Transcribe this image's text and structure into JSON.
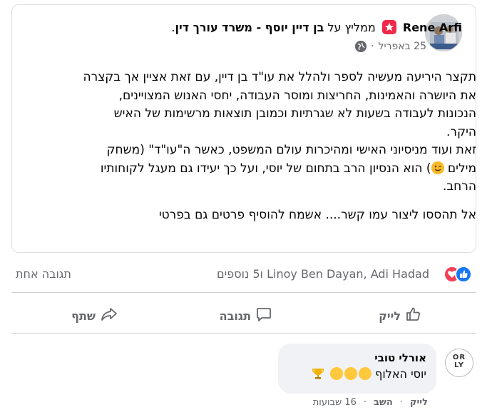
{
  "post": {
    "author": "Rene Arfi",
    "recommends_text": "ממליץ על",
    "target": "בן דיין יוסף - משרד עורך דין",
    "period": ".",
    "date": "25 באפריל",
    "date_sep": "·",
    "body_lines": [
      "תקצר היריעה מעשיה לספר ולהלל את עו\"ד בן דיין, עם זאת אציין אך בקצרה",
      "את היושרה והאמינות, החריצות ומוסר העבודה, יחסי האנוש המצויינים,",
      "הנכונות לעבודה בשעות לא שגרתיות וכמובן תוצאות מרשימות של האיש",
      "היקר.",
      "זאת ועוד מניסיוני האישי ומהיכרות עולם המשפט,  כאשר ה\"עו\"ד\" (משחק",
      "מילים",
      ") הוא הנסיון הרב בתחום של יוסי, ועל כך יעידו גם  מעגל לקוחותיו",
      "הרחב.",
      "אל תהססו ליצור עמו קשר.... אשמח להוסיף פרטים גם בפרטי"
    ]
  },
  "reactions": {
    "reactors": "Linoy Ben Dayan, Adi Hadad ו5 נוספים",
    "comment_count": "תגובה אחת"
  },
  "actions": {
    "like": "לייק",
    "comment": "תגובה",
    "share": "שתף"
  },
  "comment": {
    "avatar_line1": "OR",
    "avatar_line2": "LY",
    "author": "אורלי טובי",
    "text": "יוסי האלוף",
    "like": "לייק",
    "reply": "השב",
    "sep": "·",
    "time": "16 שבועות"
  },
  "colors": {
    "recommend_badge": "#f02849",
    "like_blue": "#1877f2",
    "love_red": "#f33e58",
    "muted_text": "#65676b"
  }
}
